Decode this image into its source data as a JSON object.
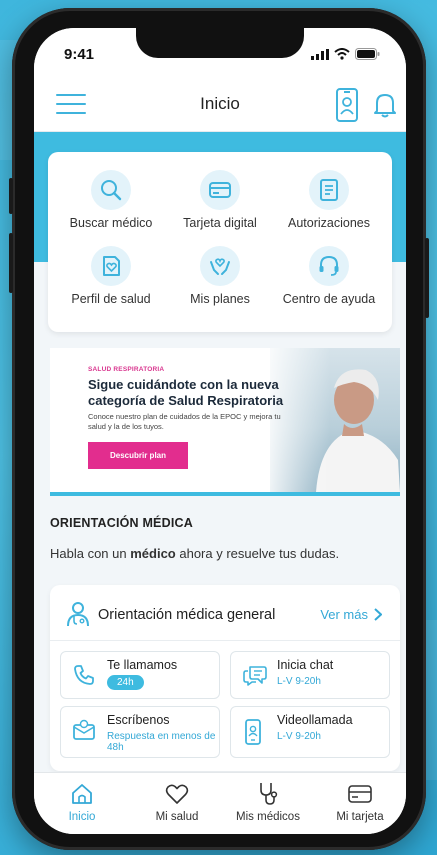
{
  "status_bar": {
    "time": "9:41"
  },
  "header": {
    "title": "Inicio"
  },
  "quick_actions": [
    {
      "label": "Buscar médico",
      "icon": "search-icon"
    },
    {
      "label": "Tarjeta digital",
      "icon": "card-icon"
    },
    {
      "label": "Autorizaciones",
      "icon": "document-icon"
    },
    {
      "label": "Perfil de salud",
      "icon": "health-profile-icon"
    },
    {
      "label": "Mis planes",
      "icon": "hands-heart-icon"
    },
    {
      "label": "Centro de ayuda",
      "icon": "headset-icon"
    }
  ],
  "banner": {
    "eyebrow": "SALUD RESPIRATORIA",
    "title": "Sigue cuidándote con la nueva categoría de Salud Respiratoria",
    "description": "Conoce nuestro plan de cuidados de la EPOC y mejora tu salud y la de los tuyos.",
    "button_label": "Descubrir plan"
  },
  "orientation": {
    "section_title": "ORIENTACIÓN MÉDICA",
    "desc_before": "Habla con un ",
    "desc_bold": "médico",
    "desc_after": " ahora y resuelve tus dudas.",
    "card_title": "Orientación médica general",
    "see_more": "Ver más",
    "options": [
      {
        "title": "Te llamamos",
        "badge": "24h",
        "icon": "phone-icon"
      },
      {
        "title": "Inicia chat",
        "subtitle": "L-V 9-20h",
        "icon": "chat-icon"
      },
      {
        "title": "Escríbenos",
        "subtitle": "Respuesta en menos de 48h",
        "icon": "email-icon"
      },
      {
        "title": "Videollamada",
        "subtitle": "L-V 9-20h",
        "icon": "video-call-icon"
      }
    ]
  },
  "tabbar": [
    {
      "label": "Inicio",
      "icon": "home-icon",
      "active": true
    },
    {
      "label": "Mi salud",
      "icon": "heart-icon"
    },
    {
      "label": "Mis médicos",
      "icon": "stethoscope-icon"
    },
    {
      "label": "Mi tarjeta",
      "icon": "card-icon"
    }
  ],
  "colors": {
    "accent": "#3ebbe0",
    "brand_pink": "#e22d8e",
    "link": "#33a8d6"
  }
}
